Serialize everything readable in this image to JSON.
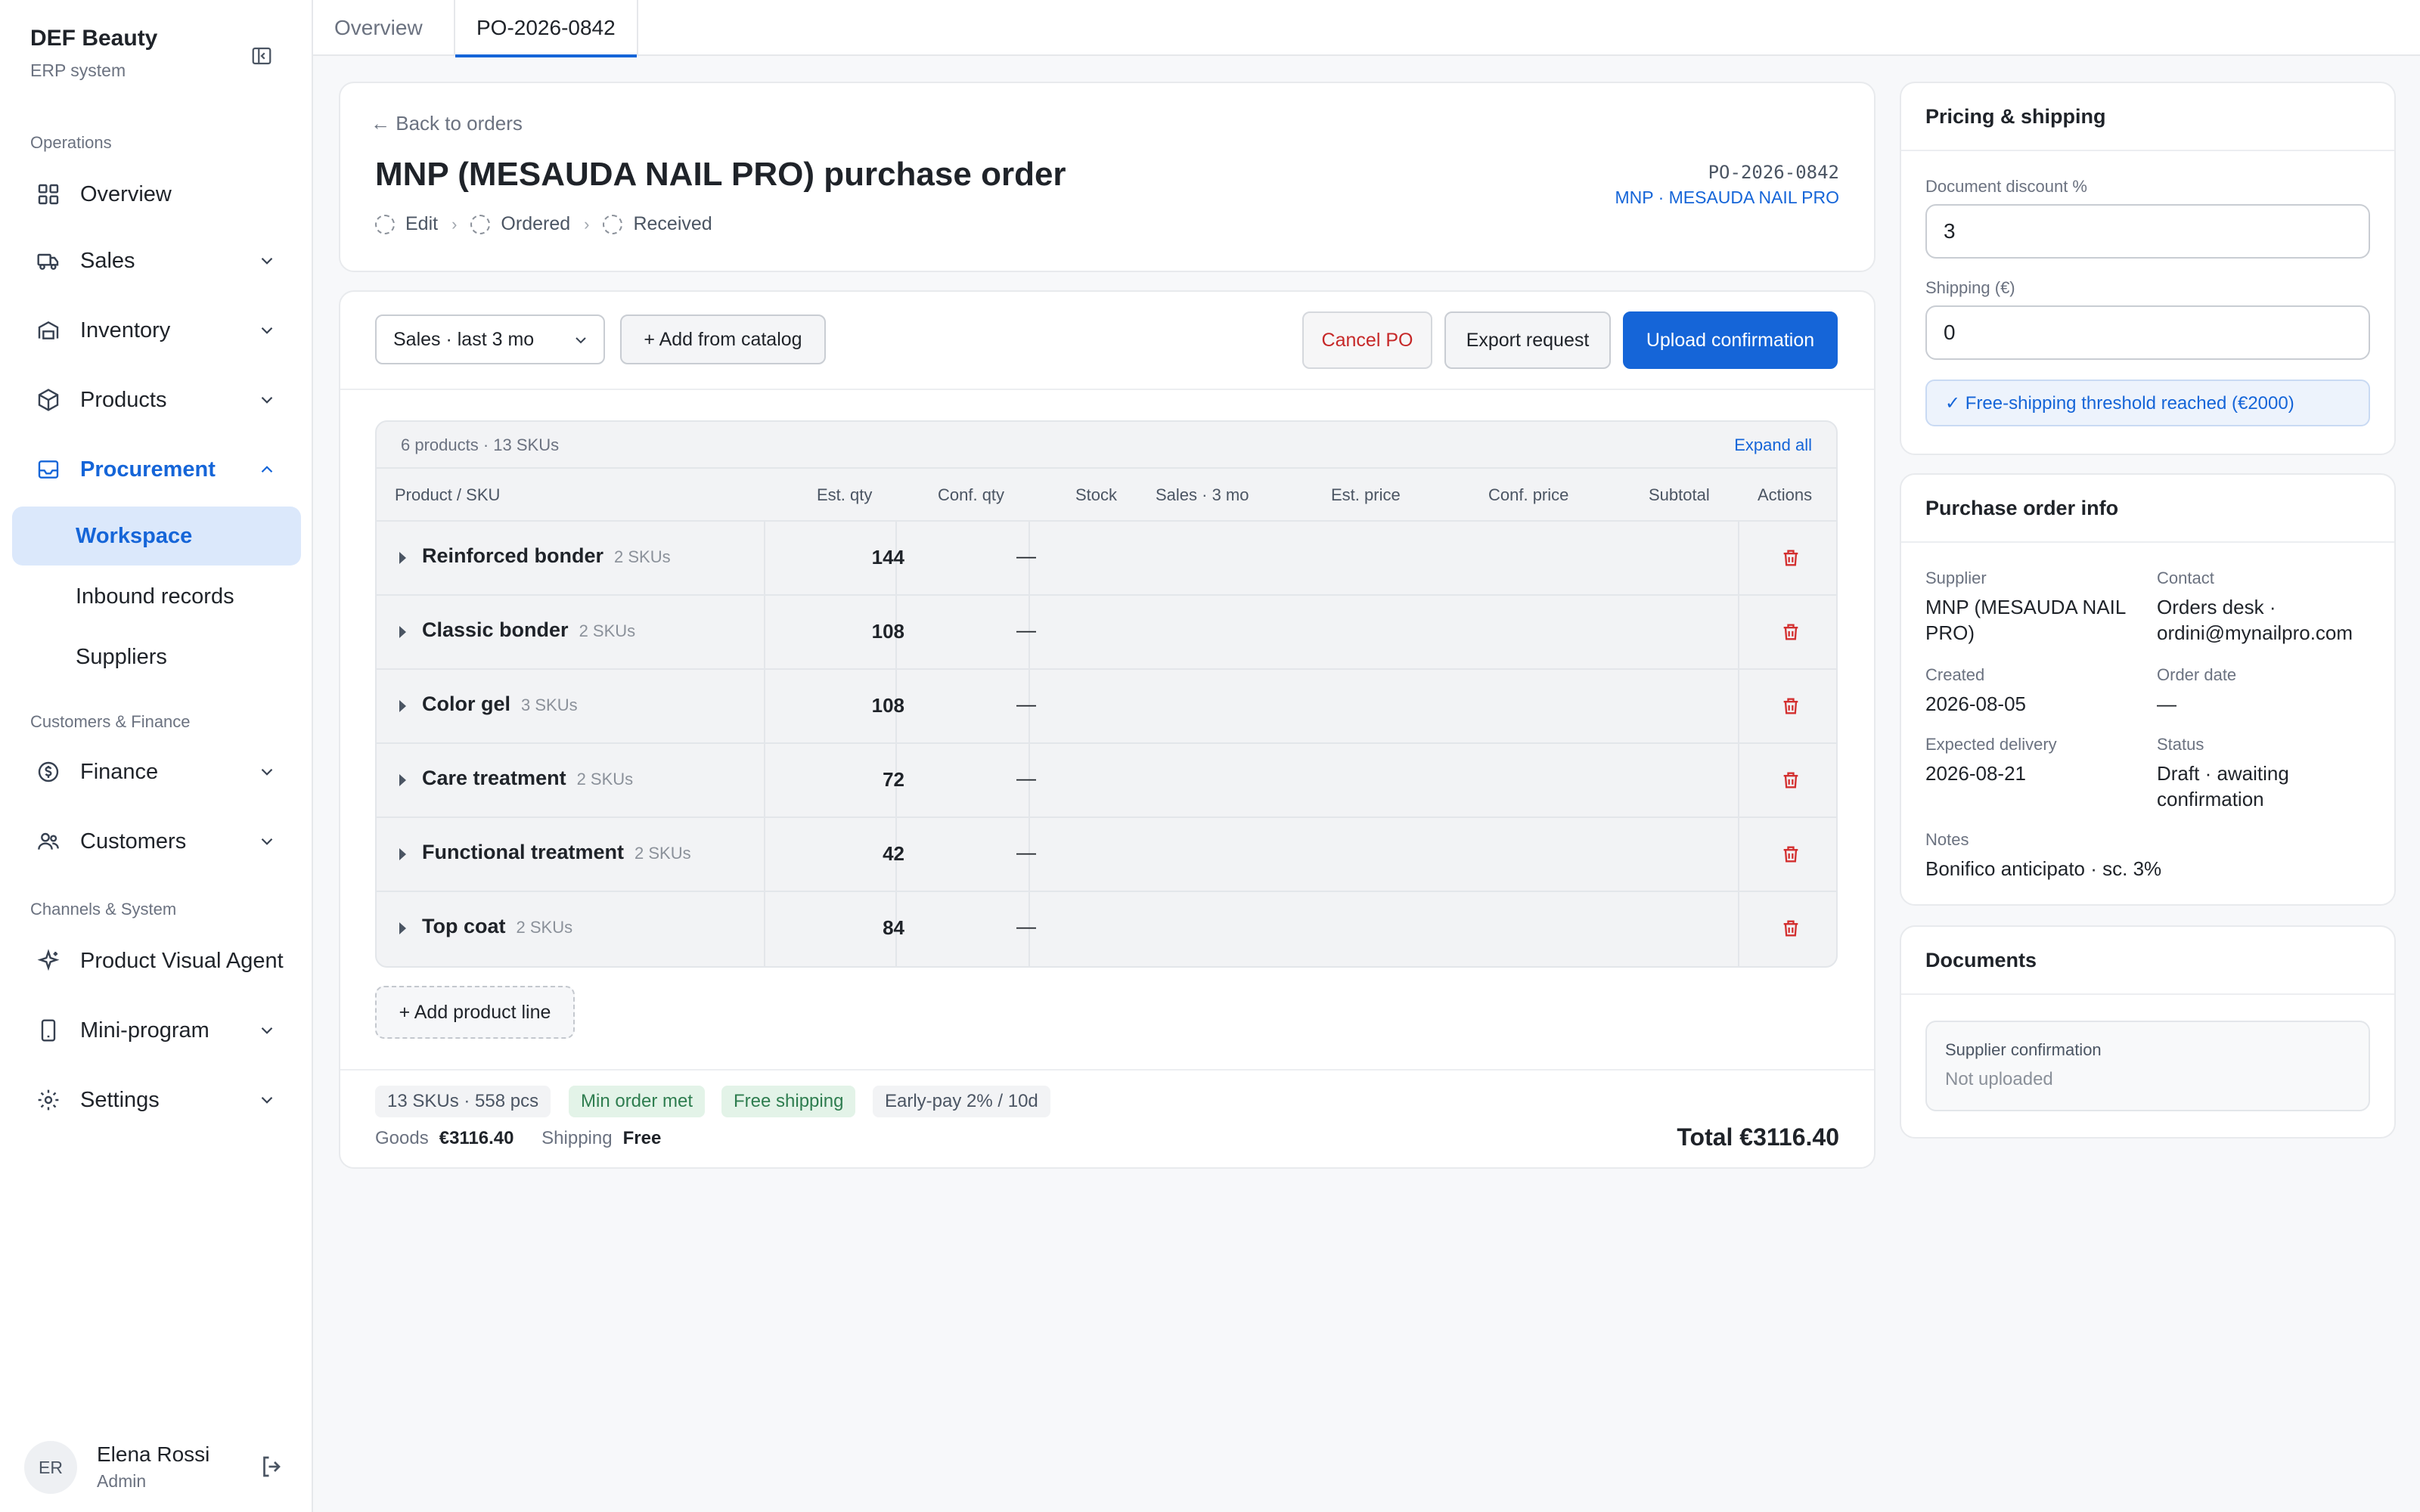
{
  "brand": {
    "name": "DEF Beauty",
    "subtitle": "ERP system"
  },
  "sidebar": {
    "sections": [
      "Operations",
      "Customers & Finance",
      "Channels & System"
    ],
    "items": [
      {
        "label": "Overview",
        "icon": "grid-icon"
      },
      {
        "label": "Sales",
        "icon": "truck-icon"
      },
      {
        "label": "Inventory",
        "icon": "warehouse-icon"
      },
      {
        "label": "Products",
        "icon": "box-icon"
      },
      {
        "label": "Procurement",
        "icon": "inbox-icon"
      },
      {
        "label": "Finance",
        "icon": "coin-icon"
      },
      {
        "label": "Customers",
        "icon": "users-icon"
      },
      {
        "label": "Product Visual Agent",
        "icon": "sparkle-icon"
      },
      {
        "label": "Mini-program",
        "icon": "phone-icon"
      },
      {
        "label": "Settings",
        "icon": "gear-icon"
      }
    ],
    "procurement_sub": [
      "Workspace",
      "Inbound records",
      "Suppliers"
    ]
  },
  "user": {
    "initials": "ER",
    "name": "Elena Rossi",
    "role": "Admin"
  },
  "tabs": [
    "Overview",
    "PO-2026-0842"
  ],
  "po": {
    "back": "← Back to orders",
    "title": "MNP (MESAUDA NAIL PRO) purchase order",
    "steps": [
      "Edit",
      "Ordered",
      "Received"
    ],
    "code": "PO-2026-0842",
    "supplier_link": "MNP · MESAUDA NAIL PRO"
  },
  "toolbar": {
    "select_value": "Sales · last 3 mo",
    "add_catalog": "+ Add from catalog",
    "cancel": "Cancel PO",
    "export": "Export request",
    "upload": "Upload confirmation"
  },
  "table": {
    "summary": "6 products · 13 SKUs",
    "expand_all": "Expand all",
    "headers": [
      "Product / SKU",
      "Est. qty",
      "Conf. qty",
      "Stock",
      "Sales · 3 mo",
      "Est. price",
      "Conf. price",
      "Subtotal",
      "Actions"
    ],
    "rows": [
      {
        "name": "Reinforced bonder",
        "skus": "2 SKUs",
        "est_qty": "144",
        "conf_qty": "—"
      },
      {
        "name": "Classic bonder",
        "skus": "2 SKUs",
        "est_qty": "108",
        "conf_qty": "—"
      },
      {
        "name": "Color gel",
        "skus": "3 SKUs",
        "est_qty": "108",
        "conf_qty": "—"
      },
      {
        "name": "Care treatment",
        "skus": "2 SKUs",
        "est_qty": "72",
        "conf_qty": "—"
      },
      {
        "name": "Functional treatment",
        "skus": "2 SKUs",
        "est_qty": "42",
        "conf_qty": "—"
      },
      {
        "name": "Top coat",
        "skus": "2 SKUs",
        "est_qty": "84",
        "conf_qty": "—"
      }
    ],
    "add_line": "+ Add product line"
  },
  "footer": {
    "chips": [
      "13 SKUs · 558 pcs",
      "Min order met",
      "Free shipping",
      "Early-pay 2% / 10d"
    ],
    "goods_label": "Goods",
    "goods_value": "€3116.40",
    "shipping_label": "Shipping",
    "shipping_value": "Free",
    "total": "Total €3116.40"
  },
  "pricing": {
    "title": "Pricing & shipping",
    "discount_label": "Document discount %",
    "discount_value": "3",
    "shipping_label": "Shipping (€)",
    "shipping_value": "0",
    "notice": "✓ Free-shipping threshold reached (€2000)"
  },
  "info": {
    "title": "Purchase order info",
    "supplier_label": "Supplier",
    "supplier": "MNP (MESAUDA NAIL PRO)",
    "contact_label": "Contact",
    "contact": "Orders desk · ordini@mynailpro.com",
    "created_label": "Created",
    "created": "2026-08-05",
    "order_date_label": "Order date",
    "order_date": "—",
    "expected_label": "Expected delivery",
    "expected": "2026-08-21",
    "status_label": "Status",
    "status": "Draft · awaiting confirmation",
    "notes_label": "Notes",
    "notes": "Bonifico anticipato · sc. 3%"
  },
  "documents": {
    "title": "Documents",
    "doc_title": "Supplier confirmation",
    "doc_status": "Not uploaded"
  },
  "colors": {
    "accent": "#1565d8",
    "danger": "#c62828",
    "success": "#2e7d4f"
  }
}
